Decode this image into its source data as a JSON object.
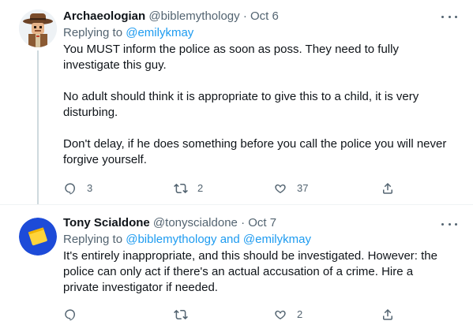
{
  "tweets": [
    {
      "display_name": "Archaeologian",
      "handle": "@biblemythology",
      "separator": "·",
      "date": "Oct 6",
      "replying_label": "Replying to",
      "mention_1": "@emilykmay",
      "paragraphs": [
        "You MUST inform the police as soon as poss. They need to fully investigate this guy.",
        "No adult should think it is appropriate to give this to a child, it is very disturbing.",
        "Don't delay, if he does something before you call the police you will never forgive yourself."
      ],
      "reply_count": "3",
      "retweet_count": "2",
      "like_count": "37",
      "avatar_icon": "cowboy-archaeologist-avatar"
    },
    {
      "display_name": "Tony Scialdone",
      "handle": "@tonyscialdone",
      "separator": "·",
      "date": "Oct 7",
      "replying_label": "Replying to",
      "mention_1": "@biblemythology",
      "conjunction": "and",
      "mention_2": "@emilykmay",
      "paragraphs": [
        "It's entirely inappropriate, and this should be investigated. However: the police can only act if there's an actual accusation of a crime. Hire a private investigator if needed."
      ],
      "reply_count": "",
      "retweet_count": "",
      "like_count": "2",
      "avatar_icon": "yellow-note-avatar"
    }
  ],
  "colors": {
    "text_primary": "#0f1419",
    "text_secondary": "#536471",
    "link": "#1d9bf0",
    "divider": "#eff3f4",
    "thread_line": "#cfd9de",
    "avatar_blue": "#1d4bd8",
    "avatar_yellow": "#ffd43b"
  }
}
